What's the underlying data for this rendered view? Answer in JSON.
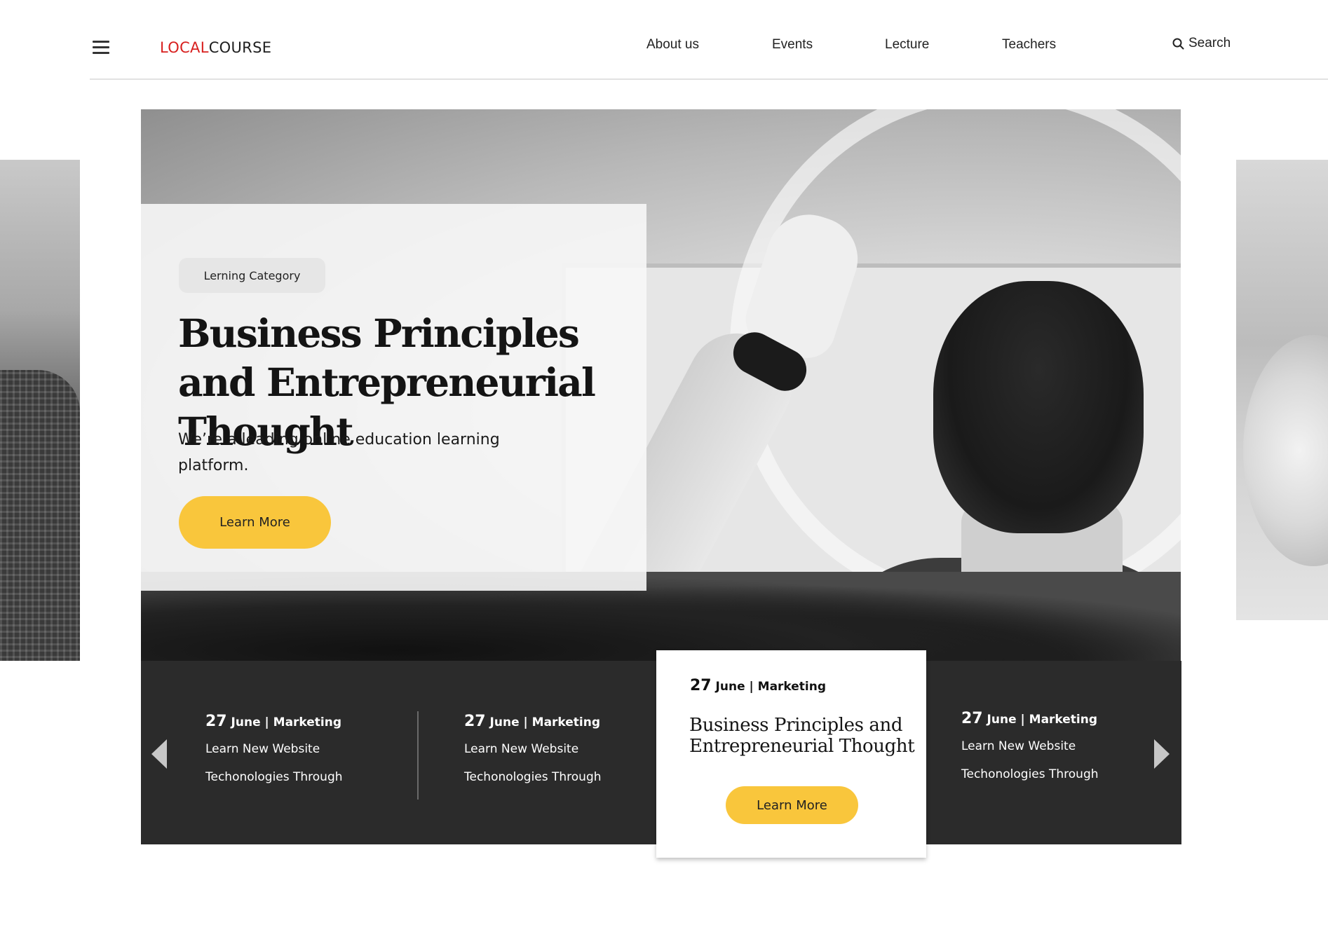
{
  "header": {
    "logo_part1": "LOCAL",
    "logo_part2": "COURSE",
    "nav": [
      "About us",
      "Events",
      "Lecture",
      "Teachers"
    ],
    "search_label": "Search"
  },
  "hero": {
    "category": "Lerning Category",
    "title": "Business Principles and Entrepreneurial Thought",
    "subtitle": "We’re a leading online education learning platform.",
    "button_label": "Learn More"
  },
  "events": [
    {
      "day": "27",
      "rest": " June | Marketing",
      "line1": "Learn New Website",
      "line2": "Techonologies Through"
    },
    {
      "day": "27",
      "rest": " June | Marketing",
      "line1": "Learn New Website",
      "line2": "Techonologies Through"
    },
    {
      "day": "27",
      "rest": " June | Marketing",
      "line1": "Learn New Website",
      "line2": "Techonologies Through"
    }
  ],
  "featured": {
    "day": "27",
    "rest": " June | Marketing",
    "title": "Business Principles and Entrepreneurial Thought",
    "button_label": "Learn More"
  },
  "colors": {
    "accent_yellow": "#f9c63c",
    "logo_red": "#d8201f",
    "strip_dark": "#2b2b2b"
  },
  "icons": [
    "menu-icon",
    "search-icon",
    "arrow-left-icon",
    "arrow-right-icon"
  ]
}
